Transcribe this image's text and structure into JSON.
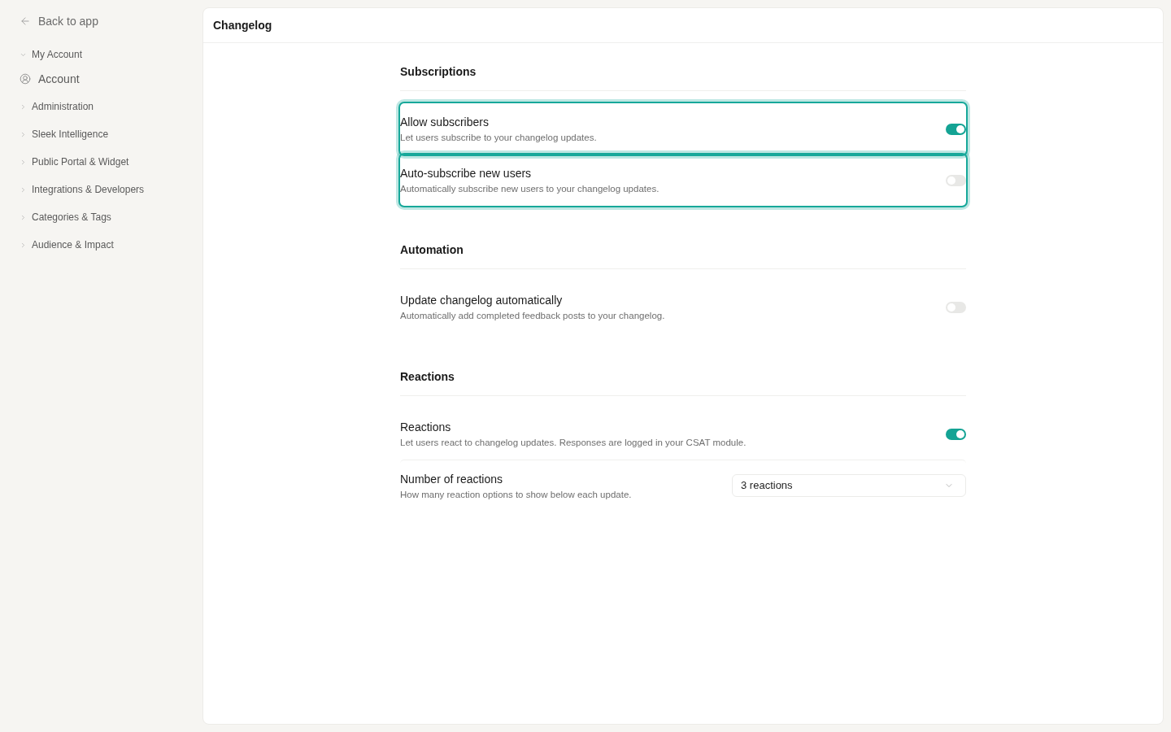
{
  "sidebar": {
    "back_link": "Back to app",
    "groups": [
      {
        "label": "My Account",
        "expanded": true,
        "children": [
          {
            "label": "Account"
          }
        ]
      },
      {
        "label": "Administration",
        "expanded": false
      },
      {
        "label": "Sleek Intelligence",
        "expanded": false
      },
      {
        "label": "Public Portal & Widget",
        "expanded": false
      },
      {
        "label": "Integrations & Developers",
        "expanded": false
      },
      {
        "label": "Categories & Tags",
        "expanded": false
      },
      {
        "label": "Audience & Impact",
        "expanded": false
      }
    ]
  },
  "header": {
    "title": "Changelog"
  },
  "sections": [
    {
      "title": "Subscriptions",
      "rows": [
        {
          "kind": "toggle",
          "title": "Allow subscribers",
          "description": "Let users subscribe to your changelog updates.",
          "on": true,
          "highlighted": true
        },
        {
          "kind": "toggle",
          "title": "Auto-subscribe new users",
          "description": "Automatically subscribe new users to your changelog updates.",
          "on": false,
          "highlighted": true
        }
      ]
    },
    {
      "title": "Automation",
      "rows": [
        {
          "kind": "toggle",
          "title": "Update changelog automatically",
          "description": "Automatically add completed feedback posts to your changelog.",
          "on": false,
          "highlighted": false
        }
      ]
    },
    {
      "title": "Reactions",
      "rows": [
        {
          "kind": "toggle",
          "title": "Reactions",
          "description": "Let users react to changelog updates. Responses are logged in your CSAT module.",
          "on": true,
          "highlighted": false
        },
        {
          "kind": "select",
          "title": "Number of reactions",
          "description": "How many reaction options to show below each update.",
          "value": "3 reactions",
          "highlighted": false
        }
      ]
    }
  ]
}
